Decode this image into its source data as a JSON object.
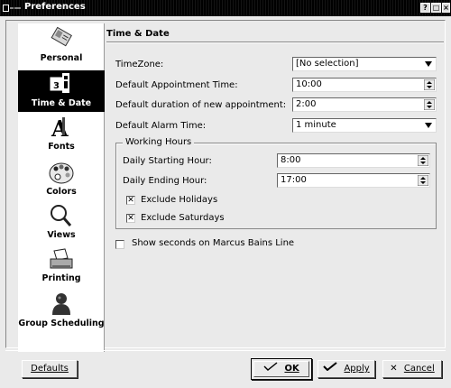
{
  "window": {
    "title": "Preferences",
    "help_btn": "?",
    "max_btn": "□",
    "close_btn": "×"
  },
  "sidebar": {
    "items": [
      {
        "label": "Personal",
        "icon": "personal-card-icon"
      },
      {
        "label": "Time & Date",
        "icon": "calendar-clock-icon",
        "selected": true
      },
      {
        "label": "Fonts",
        "icon": "fonts-icon"
      },
      {
        "label": "Colors",
        "icon": "palette-icon"
      },
      {
        "label": "Views",
        "icon": "magnifier-icon"
      },
      {
        "label": "Printing",
        "icon": "printer-icon"
      },
      {
        "label": "Group Scheduling",
        "icon": "group-person-icon"
      }
    ]
  },
  "section": {
    "title": "Time & Date"
  },
  "fields": {
    "timezone": {
      "label": "TimeZone:",
      "value": "[No selection]"
    },
    "appt_time": {
      "label": "Default Appointment Time:",
      "value": "10:00"
    },
    "duration": {
      "label": "Default duration of new appointment:",
      "value": "2:00"
    },
    "alarm": {
      "label": "Default Alarm Time:",
      "value": "1 minute"
    }
  },
  "working_hours": {
    "legend": "Working Hours",
    "start": {
      "label": "Daily Starting Hour:",
      "value": "8:00"
    },
    "end": {
      "label": "Daily Ending Hour:",
      "value": "17:00"
    },
    "exclude_holidays": {
      "label": "Exclude Holidays",
      "checked": true
    },
    "exclude_saturdays": {
      "label": "Exclude Saturdays",
      "checked": true
    }
  },
  "show_seconds": {
    "label": "Show seconds on Marcus Bains Line",
    "checked": false
  },
  "buttons": {
    "defaults": "Defaults",
    "ok": "OK",
    "apply": "Apply",
    "cancel": "Cancel"
  }
}
